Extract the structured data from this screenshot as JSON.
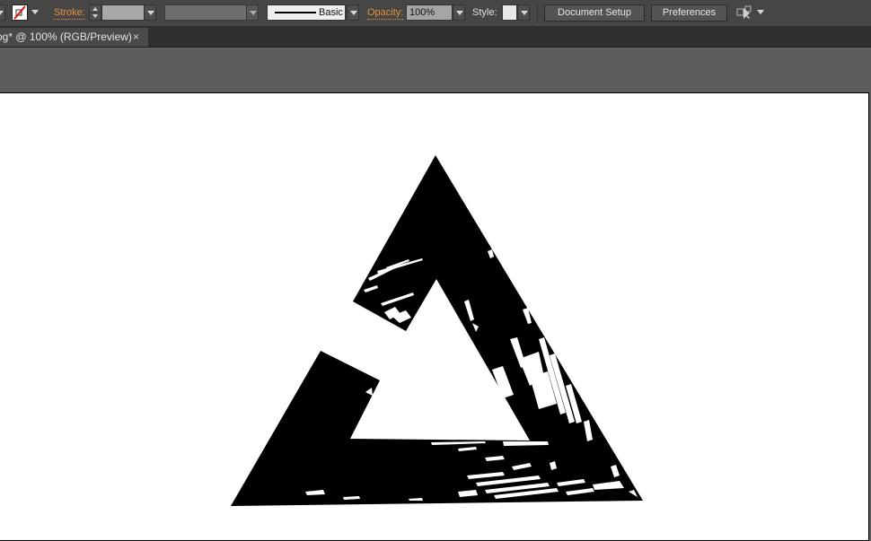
{
  "toolbar": {
    "fill_swatch": "none-fill-icon",
    "stroke_label": "Stroke:",
    "stroke_weight_value": "",
    "variable_width_value": "",
    "brush_label": "Basic",
    "opacity_label": "Opacity:",
    "opacity_value": "100%",
    "style_label": "Style:",
    "document_setup_label": "Document Setup",
    "preferences_label": "Preferences",
    "arrange_icon": "arrange-documents-icon"
  },
  "document_tab": {
    "title": "og* @ 100% (RGB/Preview)",
    "close_glyph": "×"
  },
  "artwork": {
    "description": "Grunge-textured black impossible triangle logo",
    "fill_color": "#000000",
    "background_color": "#ffffff"
  }
}
